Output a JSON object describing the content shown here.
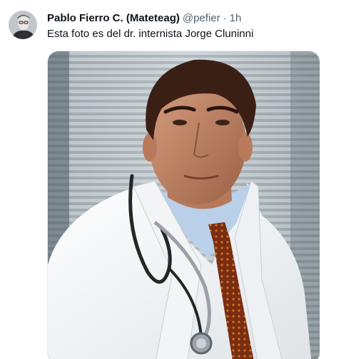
{
  "tweet": {
    "author": {
      "display_name": "Pablo Fierro C. (Mateteag)",
      "handle": "@pefier",
      "separator": "·",
      "time": "1h"
    },
    "text": "Esta foto es del dr. internista Jorge Cluninni",
    "media": {
      "alt": "Portrait of a doctor in a white coat with a stethoscope, standing in front of window blinds"
    }
  },
  "colors": {
    "primary_text": "#0f1419",
    "secondary_text": "#536471",
    "coat": "#f4f5f7",
    "blinds": "#d9dde0"
  }
}
